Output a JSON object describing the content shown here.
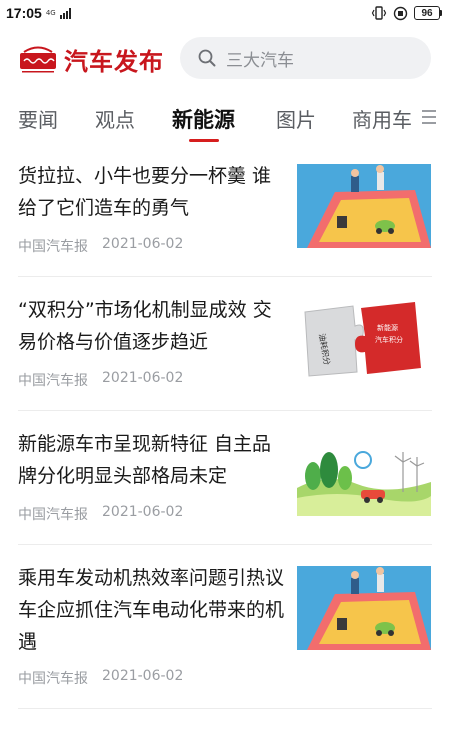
{
  "status_bar": {
    "time": "17:05",
    "network": "4G",
    "battery": "96"
  },
  "header": {
    "logo_text": "汽车发布",
    "search_placeholder": "三大汽车"
  },
  "tabs": [
    {
      "label": "要闻",
      "active": false
    },
    {
      "label": "观点",
      "active": false
    },
    {
      "label": "新能源",
      "active": true
    },
    {
      "label": "图片",
      "active": false
    },
    {
      "label": "商用车",
      "active": false
    }
  ],
  "news": [
    {
      "title": "货拉拉、小牛也要分一杯羹 谁给了它们造车的勇气",
      "source": "中国汽车报",
      "date": "2021-06-02",
      "thumb": "sandbox-illustration"
    },
    {
      "title": "“双积分”市场化机制显成效 交易价格与价值逐步趋近",
      "source": "中国汽车报",
      "date": "2021-06-02",
      "thumb": "puzzle-illustration",
      "thumb_text": [
        "油耗积分",
        "新能源汽车积分"
      ]
    },
    {
      "title": "新能源车市呈现新特征 自主品牌分化明显头部格局未定",
      "source": "中国汽车报",
      "date": "2021-06-02",
      "thumb": "green-landscape-illustration"
    },
    {
      "title": "乘用车发动机热效率问题引热议 车企应抓住汽车电动化带来的机遇",
      "source": "中国汽车报",
      "date": "2021-06-02",
      "thumb": "sandbox-illustration"
    }
  ],
  "colors": {
    "brand_red": "#c8161d",
    "tab_underline": "#d61e1e",
    "meta_gray": "#9a9da2"
  }
}
